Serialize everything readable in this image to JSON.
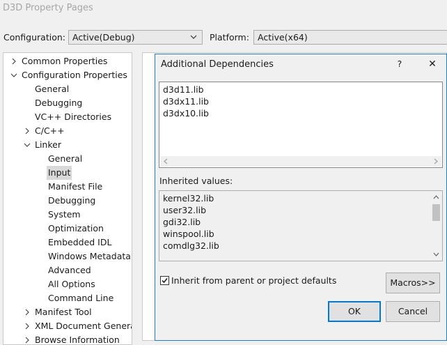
{
  "window": {
    "title": "D3D Property Pages"
  },
  "config_bar": {
    "configuration_label": "Configuration:",
    "configuration_value": "Active(Debug)",
    "platform_label": "Platform:",
    "platform_value": "Active(x64)"
  },
  "tree": {
    "items": [
      {
        "label": "Common Properties",
        "expander": "chevron-right-icon"
      },
      {
        "label": "Configuration Properties",
        "expander": "chevron-down-icon"
      },
      {
        "label": "General"
      },
      {
        "label": "Debugging"
      },
      {
        "label": "VC++ Directories"
      },
      {
        "label": "C/C++",
        "expander": "chevron-right-icon"
      },
      {
        "label": "Linker",
        "expander": "chevron-down-icon"
      },
      {
        "label": "General"
      },
      {
        "label": "Input",
        "selected": true
      },
      {
        "label": "Manifest File"
      },
      {
        "label": "Debugging"
      },
      {
        "label": "System"
      },
      {
        "label": "Optimization"
      },
      {
        "label": "Embedded IDL"
      },
      {
        "label": "Windows Metadata"
      },
      {
        "label": "Advanced"
      },
      {
        "label": "All Options"
      },
      {
        "label": "Command Line"
      },
      {
        "label": "Manifest Tool",
        "expander": "chevron-right-icon"
      },
      {
        "label": "XML Document Generat",
        "expander": "chevron-right-icon"
      },
      {
        "label": "Browse Information",
        "expander": "chevron-right-icon"
      }
    ]
  },
  "dialog": {
    "title": "Additional Dependencies",
    "help_glyph": "?",
    "close_glyph": "✕",
    "dependencies": [
      "d3d11.lib",
      "d3dx11.lib",
      "d3dx10.lib"
    ],
    "inherited_label": "Inherited values:",
    "inherited_values": [
      "kernel32.lib",
      "user32.lib",
      "gdi32.lib",
      "winspool.lib",
      "comdlg32.lib"
    ],
    "inherit_checkbox_label": "Inherit from parent or project defaults",
    "inherit_checked": true,
    "macros_button": "Macros>>",
    "ok_button": "OK",
    "cancel_button": "Cancel"
  },
  "colors": {
    "accent": "#0078d7",
    "selection": "#d9d9d9"
  }
}
